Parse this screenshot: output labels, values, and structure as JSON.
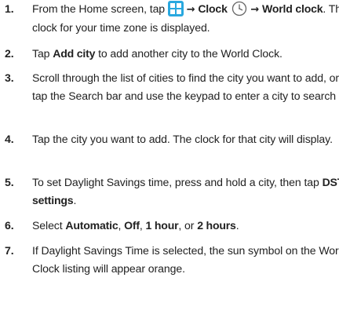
{
  "colors": {
    "apps_icon_fill": "#29A8DF",
    "text": "#222222"
  },
  "icons": {
    "apps_icon": "apps-grid-icon",
    "clock_icon": "clock-icon"
  },
  "arrow": "→",
  "steps": [
    {
      "num": "1.",
      "parts": {
        "a": "From the Home screen, tap",
        "clock": "Clock",
        "world_clock": "World clock",
        "rest": ". The clock for your time zone is displayed."
      }
    },
    {
      "num": "2.",
      "parts": {
        "a": "Tap ",
        "bold": "Add city",
        "b": " to add another city to the World Clock."
      }
    },
    {
      "num": "3.",
      "text": "Scroll through the list of cities to find the city you want to add, or tap the Search bar and use the keypad to enter a city to search for."
    },
    {
      "num": "4.",
      "text": "Tap the city you want to add. The clock for that city will display."
    },
    {
      "num": "5.",
      "parts": {
        "a": "To set Daylight Savings time, press and hold a city, then tap ",
        "bold": "DST settings",
        "b": "."
      }
    },
    {
      "num": "6.",
      "parts": {
        "a": "Select ",
        "o1": "Automatic",
        "s1": ", ",
        "o2": "Off",
        "s2": ", ",
        "o3": "1 hour",
        "s3": ", or ",
        "o4": "2 hours",
        "s4": "."
      }
    },
    {
      "num": "7.",
      "text": "If Daylight Savings Time is selected, the sun symbol on the World Clock listing will appear orange."
    }
  ]
}
